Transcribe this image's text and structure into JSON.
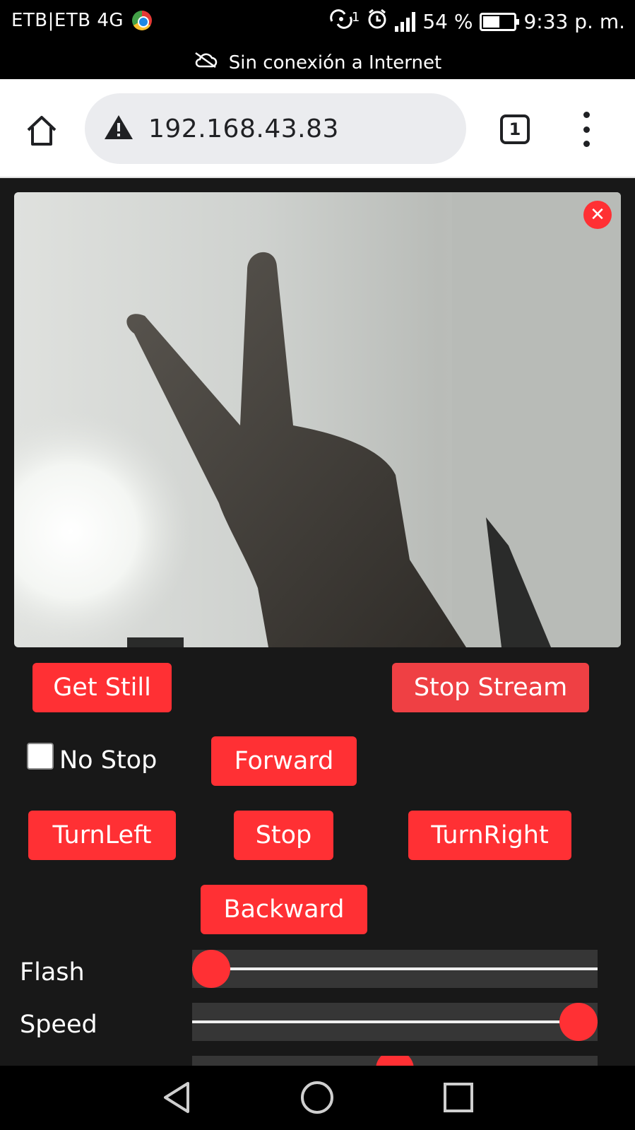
{
  "status_bar": {
    "carrier": "ETB|ETB 4G",
    "sync_count": "1",
    "battery_percent": "54 %",
    "battery_level": 0.54,
    "time": "9:33 p. m.",
    "offline_notice": "Sin conexión a Internet"
  },
  "browser": {
    "url": "192.168.43.83",
    "tab_count": "1"
  },
  "controls": {
    "get_still": "Get Still",
    "stop_stream": "Stop Stream",
    "no_stop_label": "No Stop",
    "no_stop_checked": false,
    "forward": "Forward",
    "turn_left": "TurnLeft",
    "stop": "Stop",
    "turn_right": "TurnRight",
    "backward": "Backward"
  },
  "sliders": {
    "flash_label": "Flash",
    "flash_value": 0.0,
    "speed_label": "Speed",
    "speed_value": 1.0,
    "third_value": 0.5
  },
  "colors": {
    "accent": "#ff3034",
    "background": "#181818"
  },
  "icons": {
    "close": "close-icon",
    "home": "home-icon",
    "warning": "warning-icon",
    "menu": "more-vert-icon",
    "back": "back-icon",
    "home_nav": "home-circle-icon",
    "recents": "recents-icon"
  }
}
